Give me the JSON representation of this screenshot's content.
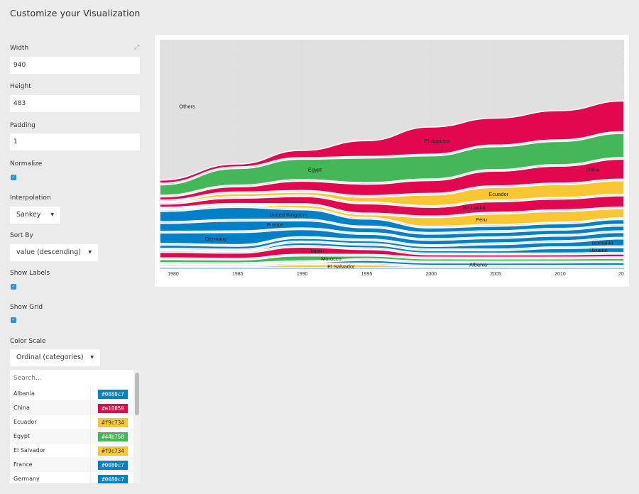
{
  "page": {
    "title": "Customize your Visualization"
  },
  "options": {
    "width": {
      "label": "Width",
      "value": "940"
    },
    "height": {
      "label": "Height",
      "value": "483"
    },
    "padding": {
      "label": "Padding",
      "value": "1"
    },
    "normalize": {
      "label": "Normalize",
      "checked": true
    },
    "interpolation": {
      "label": "Interpolation",
      "selected": "Sankey"
    },
    "sort_by": {
      "label": "Sort By",
      "selected": "value (descending)"
    },
    "show_labels": {
      "label": "Show Labels",
      "checked": true
    },
    "show_grid": {
      "label": "Show Grid",
      "checked": true
    },
    "color_scale": {
      "label": "Color Scale",
      "selected": "Ordinal (categories)"
    },
    "expand_icon": "expand-icon"
  },
  "color_list": {
    "search_placeholder": "Search...",
    "items": [
      {
        "name": "Albania",
        "color": "#0080c7"
      },
      {
        "name": "China",
        "color": "#e10850"
      },
      {
        "name": "Ecuador",
        "color": "#f9c734"
      },
      {
        "name": "Egypt",
        "color": "#44b758"
      },
      {
        "name": "El Salvador",
        "color": "#f9c734"
      },
      {
        "name": "France",
        "color": "#0080c7"
      },
      {
        "name": "Germany",
        "color": "#0080c7"
      }
    ]
  },
  "palette": {
    "blue": "#0080c7",
    "pink": "#e10850",
    "yellow": "#f9c734",
    "green": "#44b758",
    "others": "#e0e0e0"
  },
  "chart_data": {
    "type": "area",
    "subtype": "bump-chart (sankey interpolation, normalized, sorted by value descending)",
    "title": "",
    "xlabel": "",
    "ylabel": "",
    "x_ticks": [
      "1980",
      "1985",
      "1990",
      "1995",
      "2000",
      "2005",
      "2010",
      "20"
    ],
    "xlim": [
      1979,
      2015
    ],
    "normalized": true,
    "grid": true,
    "labels": [
      {
        "text": "Others",
        "x": 1980.5,
        "color": "#e0e0e0"
      },
      {
        "text": "Germany",
        "x": 1982.5,
        "color": "#0080c7"
      },
      {
        "text": "United Kingdom",
        "x": 1987.5,
        "color": "#0080c7"
      },
      {
        "text": "France",
        "x": 1987.3,
        "color": "#0080c7"
      },
      {
        "text": "Egypt",
        "x": 1990.5,
        "color": "#44b758"
      },
      {
        "text": "Japan",
        "x": 1990.6,
        "color": "#e10850"
      },
      {
        "text": "Morocco",
        "x": 1991.5,
        "color": "#44b758"
      },
      {
        "text": "El Salvador",
        "x": 1992.0,
        "color": "#f9c734"
      },
      {
        "text": "Philippines",
        "x": 1999.5,
        "color": "#e10850"
      },
      {
        "text": "Sri Lanka",
        "x": 2002.5,
        "color": "#e10850"
      },
      {
        "text": "Peru",
        "x": 2003.5,
        "color": "#f9c734"
      },
      {
        "text": "Ecuador",
        "x": 2004.5,
        "color": "#f9c734"
      },
      {
        "text": "Albania",
        "x": 2003.0,
        "color": "#0080c7"
      },
      {
        "text": "China",
        "x": 2012.0,
        "color": "#e10850"
      },
      {
        "text": "Romania",
        "x": 2012.5,
        "color": "#0080c7"
      },
      {
        "text": "Ukraine",
        "x": 2012.3,
        "color": "#0080c7"
      }
    ],
    "series": [
      {
        "name": "Others",
        "color": "#e0e0e0",
        "values_share": [
          0.58,
          0.54,
          0.5,
          0.46,
          0.42,
          0.38,
          0.34,
          0.28
        ]
      },
      {
        "name": "Philippines",
        "color": "#e10850",
        "values_share": [
          0.02,
          0.02,
          0.04,
          0.08,
          0.14,
          0.14,
          0.15,
          0.15
        ]
      },
      {
        "name": "Egypt",
        "color": "#44b758",
        "values_share": [
          0.05,
          0.08,
          0.1,
          0.12,
          0.12,
          0.12,
          0.12,
          0.12
        ]
      },
      {
        "name": "China",
        "color": "#e10850",
        "values_share": [
          0.02,
          0.03,
          0.05,
          0.06,
          0.07,
          0.08,
          0.09,
          0.1
        ]
      },
      {
        "name": "Ecuador",
        "color": "#f9c734",
        "values_share": [
          0.01,
          0.02,
          0.02,
          0.03,
          0.06,
          0.07,
          0.07,
          0.07
        ]
      },
      {
        "name": "Sri Lanka",
        "color": "#e10850",
        "values_share": [
          0.02,
          0.03,
          0.04,
          0.05,
          0.05,
          0.06,
          0.06,
          0.06
        ]
      },
      {
        "name": "Peru",
        "color": "#f9c734",
        "values_share": [
          0.01,
          0.01,
          0.02,
          0.02,
          0.05,
          0.06,
          0.06,
          0.05
        ]
      },
      {
        "name": "United Kingdom",
        "color": "#0080c7",
        "values_share": [
          0.05,
          0.06,
          0.05,
          0.04,
          0.03,
          0.03,
          0.03,
          0.03
        ]
      },
      {
        "name": "France",
        "color": "#0080c7",
        "values_share": [
          0.04,
          0.05,
          0.04,
          0.03,
          0.03,
          0.03,
          0.03,
          0.03
        ]
      },
      {
        "name": "Germany",
        "color": "#0080c7",
        "values_share": [
          0.05,
          0.06,
          0.04,
          0.03,
          0.03,
          0.03,
          0.03,
          0.03
        ]
      },
      {
        "name": "Romania",
        "color": "#0080c7",
        "values_share": [
          0.02,
          0.02,
          0.02,
          0.02,
          0.02,
          0.03,
          0.03,
          0.04
        ]
      },
      {
        "name": "Ukraine",
        "color": "#0080c7",
        "values_share": [
          0.01,
          0.01,
          0.02,
          0.02,
          0.02,
          0.02,
          0.03,
          0.03
        ]
      },
      {
        "name": "Japan",
        "color": "#e10850",
        "values_share": [
          0.03,
          0.03,
          0.04,
          0.03,
          0.02,
          0.02,
          0.02,
          0.02
        ]
      },
      {
        "name": "Morocco",
        "color": "#44b758",
        "values_share": [
          0.02,
          0.02,
          0.03,
          0.02,
          0.02,
          0.02,
          0.02,
          0.02
        ]
      },
      {
        "name": "Albania",
        "color": "#0080c7",
        "values_share": [
          0.01,
          0.01,
          0.01,
          0.02,
          0.02,
          0.02,
          0.02,
          0.02
        ]
      },
      {
        "name": "El Salvador",
        "color": "#f9c734",
        "values_share": [
          0.01,
          0.01,
          0.02,
          0.02,
          0.01,
          0.01,
          0.01,
          0.01
        ]
      }
    ],
    "x": [
      1980,
      1985,
      1990,
      1995,
      2000,
      2005,
      2010,
      2014
    ]
  }
}
